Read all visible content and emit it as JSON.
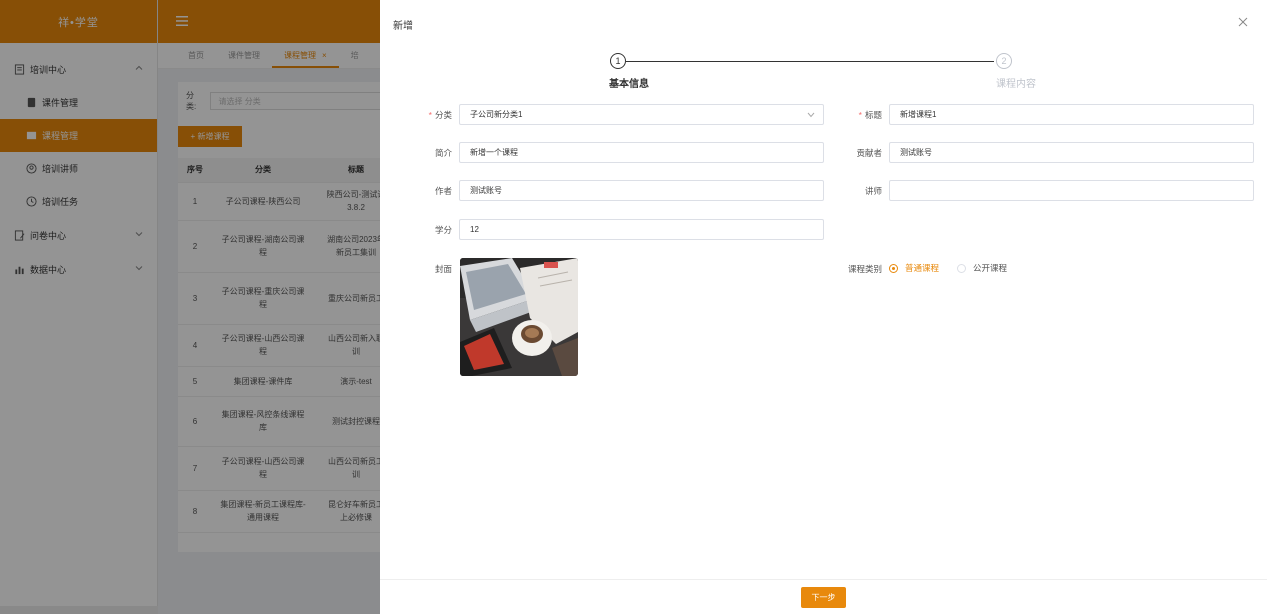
{
  "app": {
    "logo": "祥•学堂"
  },
  "sidebar": {
    "groups": [
      {
        "label": "培训中心",
        "items": [
          {
            "label": "课件管理"
          },
          {
            "label": "课程管理"
          },
          {
            "label": "培训讲师"
          },
          {
            "label": "培训任务"
          }
        ]
      },
      {
        "label": "问卷中心"
      },
      {
        "label": "数据中心"
      }
    ]
  },
  "tabs": [
    {
      "label": "首页"
    },
    {
      "label": "课件管理"
    },
    {
      "label": "课程管理",
      "close": "×"
    },
    {
      "label": "培"
    }
  ],
  "list": {
    "filter_label": "分类:",
    "filter_placeholder": "请选择 分类",
    "add_button": "+ 新增课程",
    "columns": [
      "序号",
      "分类",
      "标题"
    ],
    "rows": [
      {
        "idx": "1",
        "cat": "子公司课程-陕西公司",
        "title": "陕西公司-测试课\n3.8.2"
      },
      {
        "idx": "2",
        "cat": "子公司课程-湖南公司课\n程",
        "title": "湖南公司2023年\n新员工集训"
      },
      {
        "idx": "3",
        "cat": "子公司课程-重庆公司课\n程",
        "title": "重庆公司新员工"
      },
      {
        "idx": "4",
        "cat": "子公司课程-山西公司课\n程",
        "title": "山西公司新入职\n训"
      },
      {
        "idx": "5",
        "cat": "集团课程-课件库",
        "title": "演示-test"
      },
      {
        "idx": "6",
        "cat": "集团课程-风控条线课程\n库",
        "title": "测试封控课程"
      },
      {
        "idx": "7",
        "cat": "子公司课程-山西公司课\n程",
        "title": "山西公司新员工\n训"
      },
      {
        "idx": "8",
        "cat": "集团课程-新员工课程库-\n通用课程",
        "title": "昆仑好车新员工\n上必修课"
      }
    ]
  },
  "drawer": {
    "title": "新增",
    "steps": [
      {
        "num": "1",
        "title": "基本信息"
      },
      {
        "num": "2",
        "title": "课程内容"
      }
    ],
    "form": {
      "category": {
        "label": "分类",
        "required_mark": "*",
        "value": "子公司新分类1"
      },
      "title": {
        "label": "标题",
        "required_mark": "*",
        "value": "新增课程1"
      },
      "intro": {
        "label": "简介",
        "value": "新增一个课程"
      },
      "contributor": {
        "label": "贡献者",
        "value": "测试账号"
      },
      "author": {
        "label": "作者",
        "value": "测试账号"
      },
      "lecturer": {
        "label": "讲师",
        "value": ""
      },
      "credit": {
        "label": "学分",
        "value": "12"
      },
      "cover": {
        "label": "封面"
      },
      "course_type": {
        "label": "课程类别",
        "options": [
          "普通课程",
          "公开课程"
        ],
        "selected": "普通课程"
      }
    },
    "next_button": "下一步"
  },
  "colors": {
    "accent": "#e8890c",
    "required": "#f56c6c"
  }
}
